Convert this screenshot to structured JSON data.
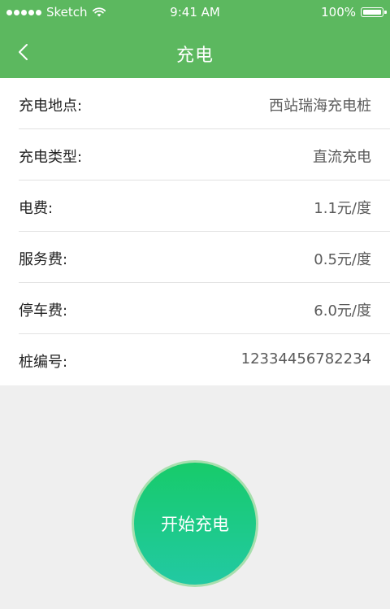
{
  "status_bar": {
    "carrier": "Sketch",
    "time": "9:41 AM",
    "battery": "100%"
  },
  "nav": {
    "title": "充电",
    "back_icon": "chevron-left-icon"
  },
  "details": [
    {
      "label": "充电地点:",
      "value": "西站瑞海充电桩"
    },
    {
      "label": "充电类型:",
      "value": "直流充电"
    },
    {
      "label": "电费:",
      "value": "1.1元/度"
    },
    {
      "label": "服务费:",
      "value": "0.5元/度"
    },
    {
      "label": "停车费:",
      "value": "6.0元/度"
    },
    {
      "label": "桩编号:",
      "value": "12334456782234"
    }
  ],
  "action": {
    "start_label": "开始充电"
  },
  "colors": {
    "header": "#5cb85f",
    "button_top": "#17cb6a",
    "button_bottom": "#22c9a3",
    "button_ring": "#a8dfae",
    "background": "#efefef"
  }
}
